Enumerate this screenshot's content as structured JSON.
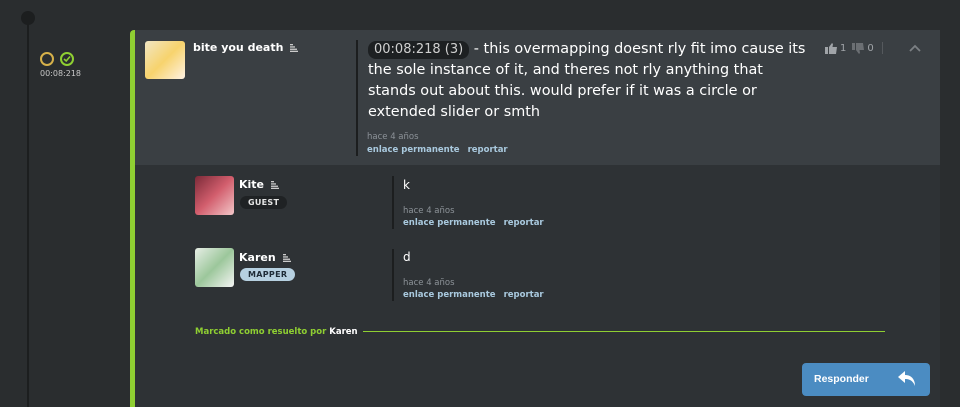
{
  "timeline": {
    "timestamp": "00:08:218"
  },
  "main_post": {
    "username": "bite you death",
    "timestamp_chip": "00:08:218 (3)",
    "message": " - this overmapping doesnt rly fit imo cause its the sole instance of it, and theres not rly anything that stands out about this. would prefer if it was a circle or extended slider or smth",
    "time_ago": "hace 4 años",
    "permalink": "enlace permanente",
    "report": "reportar",
    "upvotes": "1",
    "downvotes": "0"
  },
  "replies": [
    {
      "username": "Kite",
      "badge": "GUEST",
      "message": "k",
      "time_ago": "hace 4 años",
      "permalink": "enlace permanente",
      "report": "reportar"
    },
    {
      "username": "Karen",
      "badge": "MAPPER",
      "message": "d",
      "time_ago": "hace 4 años",
      "permalink": "enlace permanente",
      "report": "reportar"
    }
  ],
  "resolved": {
    "text": "Marcado como resuelto por ",
    "by": "Karen"
  },
  "reply_button": {
    "label": "Responder"
  },
  "colors": {
    "accent_green": "#8fcf32",
    "pending_yellow": "#d6b14a",
    "button_blue": "#4b8cc2",
    "mapper_badge": "#b6d0e0"
  },
  "icons": [
    "list-icon",
    "thumbs-up-icon",
    "thumbs-down-icon",
    "chevron-up-icon",
    "reply-arrow-icon",
    "status-pending-icon",
    "status-resolved-icon"
  ]
}
